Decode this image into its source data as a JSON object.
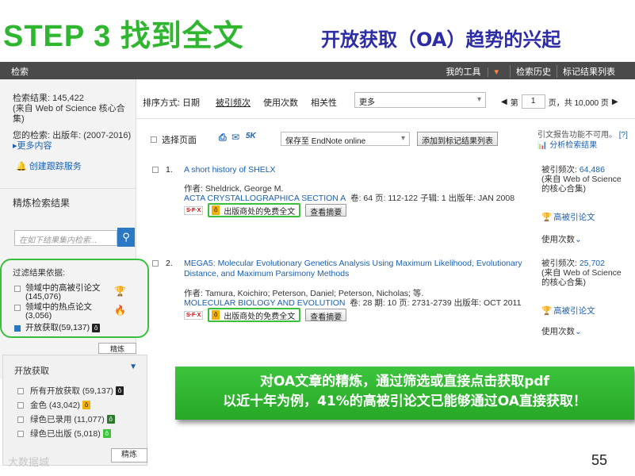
{
  "slide": {
    "title": "STEP 3 找到全文",
    "subtitle": "开放获取（OA）趋势的兴起",
    "page_number": "55",
    "watermark": "大数据城"
  },
  "topbar": {
    "search_link": "检索",
    "nav": [
      "我的工具",
      "检索历史",
      "标记结果列表"
    ]
  },
  "sidebar": {
    "results_line1": "检索结果: 145,422",
    "results_line2": "(来自 Web of Science 核心合集)",
    "history_line": "您的检索: 出版年: (2007-2016)",
    "more_link": "更多内容",
    "alert_link": "创建跟踪服务",
    "refine_title": "精炼检索结果",
    "search_placeholder": "在如下结果集内检索...",
    "filter_title": "过滤结果依据:",
    "filters": [
      {
        "label": "领域中的高被引论文",
        "count": "(145,076)",
        "checked": false
      },
      {
        "label": "领域中的热点论文",
        "count": "(3,056)",
        "checked": false
      },
      {
        "label": "开放获取",
        "count": "(59,137)",
        "checked": true
      }
    ],
    "refine_btn": "精炼"
  },
  "sortbar": {
    "label": "排序方式:",
    "options": [
      "日期",
      "被引频次",
      "使用次数",
      "相关性"
    ],
    "more_select": "更多",
    "page_label": "第",
    "page_value": "1",
    "page_total": "页，共 10,000 页"
  },
  "toolbar": {
    "select_page": "选择页面",
    "endnote": "保存至 EndNote online",
    "add_mark": "添加到标记结果列表",
    "cite_note": "引文报告功能不可用。",
    "analyze": "分析检索结果",
    "fivek": "5K"
  },
  "records": [
    {
      "num": "1.",
      "title": "A short history of SHELX",
      "authors": "作者: Sheldrick, George M.",
      "journal": "ACTA CRYSTALLOGRAPHICA SECTION A",
      "meta": "卷: 64  页: 112-122  子辑: 1  出版年: JAN 2008",
      "sfx": "S·F·X",
      "free_btn": "出版商处的免费全文",
      "abstract_btn": "查看摘要",
      "cite_label": "被引频次:",
      "cite_count": "64,486",
      "cite_source": "(来自 Web of Science 的核心合集)",
      "highly_cited": "高被引论文",
      "usage": "使用次数"
    },
    {
      "num": "2.",
      "title": "MEGA5: Molecular Evolutionary Genetics Analysis Using Maximum Likelihood, Evolutionary Distance, and Maximum Parsimony Methods",
      "authors": "作者: Tamura, Koichiro; Peterson, Daniel; Peterson, Nicholas; 等.",
      "journal": "MOLECULAR BIOLOGY AND EVOLUTION",
      "meta": "卷: 28  期: 10  页: 2731-2739  出版年: OCT 2011",
      "sfx": "S·F·X",
      "free_btn": "出版商处的免费全文",
      "abstract_btn": "查看摘要",
      "cite_label": "被引频次:",
      "cite_count": "25,702",
      "cite_source": "(来自 Web of Science 的核心合集)",
      "highly_cited": "高被引论文",
      "usage": "使用次数"
    }
  ],
  "oa_panel": {
    "title": "开放获取",
    "rows": [
      {
        "label": "所有开放获取 (59,137)",
        "badge_color": "#222222"
      },
      {
        "label": "金色 (43,042)",
        "badge_color": "#f2b000"
      },
      {
        "label": "绿色已录用 (11,077)",
        "badge_color": "#2a7a2a"
      },
      {
        "label": "绿色已出版 (5,018)",
        "badge_color": "#3cc43c"
      }
    ],
    "button": "精炼"
  },
  "callout": {
    "line1": "对OA文章的精炼，通过筛选或直接点击获取pdf",
    "line2": "以近十年为例，41%的高被引论文已能够通过OA直接获取！"
  },
  "colors": {
    "accent_green": "#3cbf3c",
    "title_green": "#2fb62f",
    "subtitle_blue": "#2c2ca8",
    "link_blue": "#1a5fb4",
    "topbar_bg": "#4a4a4a"
  }
}
